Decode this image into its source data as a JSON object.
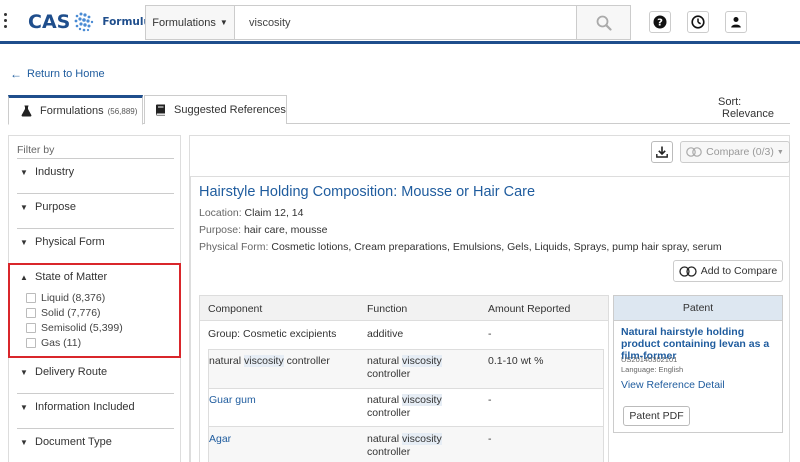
{
  "header": {
    "logo_cas": "CAS",
    "logo_product": "Formulus",
    "search_type": "Formulations",
    "search_value": "viscosity",
    "buttons": [
      "help-icon",
      "history-icon",
      "user-icon"
    ]
  },
  "nav": {
    "back_label": "Return to Home"
  },
  "tabs": [
    {
      "label": "Formulations",
      "count": "(56,889)",
      "active": true
    },
    {
      "label": "Suggested References",
      "count": "",
      "active": false
    }
  ],
  "sort": {
    "label": "Sort:",
    "value": "Relevance"
  },
  "filter": {
    "title": "Filter by",
    "sections": [
      {
        "label": "Industry",
        "expanded": false
      },
      {
        "label": "Purpose",
        "expanded": false
      },
      {
        "label": "Physical Form",
        "expanded": false
      },
      {
        "label": "State of Matter",
        "expanded": true
      },
      {
        "label": "Delivery Route",
        "expanded": false
      },
      {
        "label": "Information Included",
        "expanded": false
      },
      {
        "label": "Document Type",
        "expanded": false
      }
    ],
    "state_of_matter_options": [
      {
        "label": "Liquid (8,376)"
      },
      {
        "label": "Solid (7,776)"
      },
      {
        "label": "Semisolid (5,399)"
      },
      {
        "label": "Gas (11)"
      }
    ]
  },
  "toolbar": {
    "compare_label": "Compare (0/3)"
  },
  "result": {
    "title": "Hairstyle Holding Composition: Mousse or Hair Care",
    "location_label": "Location:",
    "location_value": "Claim 12, 14",
    "purpose_label": "Purpose:",
    "purpose_value": "hair care, mousse",
    "physical_form_label": "Physical Form:",
    "physical_form_value": "Cosmetic lotions, Cream preparations, Emulsions, Gels, Liquids, Sprays, pump hair spray, serum",
    "add_compare_label": "Add to Compare",
    "table": {
      "headers": [
        "Component",
        "Function",
        "Amount Reported"
      ],
      "group_row": {
        "component": "Group: Cosmetic excipients",
        "function": "additive",
        "amount": "-"
      },
      "rows": [
        {
          "component_pre": "natural ",
          "component_hl": "viscosity",
          "component_post": " controller",
          "function_pre": "natural ",
          "function_hl": "viscosity",
          "function_post": "controller",
          "amount": "0.1-10 wt %"
        },
        {
          "component": "Guar gum",
          "function_pre": "natural ",
          "function_hl": "viscosity",
          "function_post": "controller",
          "amount": "-"
        },
        {
          "component": "Agar",
          "function_pre": "natural ",
          "function_hl": "viscosity",
          "function_post": "controller",
          "amount": "-"
        }
      ]
    },
    "patent": {
      "header": "Patent",
      "title": "Natural hairstyle holding product containing levan as a film-former",
      "number": "US20140302101",
      "language": "Language: English",
      "detail_link": "View Reference Detail",
      "pdf_label": "Patent PDF"
    }
  },
  "colors": {
    "brand": "#1f4e8c",
    "link": "#1f5c9e",
    "highlight_border": "#d9262b"
  }
}
